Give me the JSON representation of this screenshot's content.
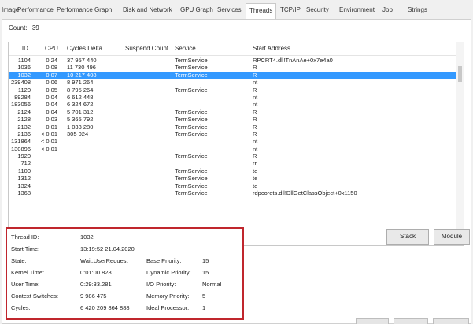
{
  "tabs": [
    "Image",
    "Performance",
    "Performance Graph",
    "Disk and Network",
    "GPU Graph",
    "Services",
    "Threads",
    "TCP/IP",
    "Security",
    "Environment",
    "Job",
    "Strings"
  ],
  "active_tab": "Threads",
  "count_label": "Count:",
  "count_value": "39",
  "columns": {
    "tid": "TID",
    "cpu": "CPU",
    "cycles": "Cycles Delta",
    "suspend": "Suspend Count",
    "service": "Service",
    "start": "Start Address"
  },
  "rows": [
    {
      "tid": "1104",
      "cpu": "0.24",
      "cycles": "37 957 440",
      "service": "TermService",
      "start": "RPCRT4.dll!TnAnAe+0x7e4a0"
    },
    {
      "tid": "1036",
      "cpu": "0.08",
      "cycles": "11 730 496",
      "service": "TermService",
      "start": "R"
    },
    {
      "tid": "1032",
      "cpu": "0.07",
      "cycles": "10 217 408",
      "service": "TermService",
      "start": "R",
      "selected": true
    },
    {
      "tid": "239408",
      "cpu": "0.06",
      "cycles": "8 971 264",
      "service": "",
      "start": "nt"
    },
    {
      "tid": "1120",
      "cpu": "0.05",
      "cycles": "8 795 264",
      "service": "TermService",
      "start": "R"
    },
    {
      "tid": "89284",
      "cpu": "0.04",
      "cycles": "6 612 448",
      "service": "",
      "start": "nt"
    },
    {
      "tid": "183056",
      "cpu": "0.04",
      "cycles": "6 324 672",
      "service": "",
      "start": "nt"
    },
    {
      "tid": "2124",
      "cpu": "0.04",
      "cycles": "5 701 312",
      "service": "TermService",
      "start": "R"
    },
    {
      "tid": "2128",
      "cpu": "0.03",
      "cycles": "5 365 792",
      "service": "TermService",
      "start": "R"
    },
    {
      "tid": "2132",
      "cpu": "0.01",
      "cycles": "1 033 280",
      "service": "TermService",
      "start": "R"
    },
    {
      "tid": "2136",
      "cpu": "< 0.01",
      "cycles": "305 024",
      "service": "TermService",
      "start": "R"
    },
    {
      "tid": "131864",
      "cpu": "< 0.01",
      "cycles": "",
      "service": "",
      "start": "nt"
    },
    {
      "tid": "130896",
      "cpu": "< 0.01",
      "cycles": "",
      "service": "",
      "start": "nt"
    },
    {
      "tid": "1920",
      "cpu": "",
      "cycles": "",
      "service": "TermService",
      "start": "R"
    },
    {
      "tid": "712",
      "cpu": "",
      "cycles": "",
      "service": "",
      "start": "rr"
    },
    {
      "tid": "1100",
      "cpu": "",
      "cycles": "",
      "service": "TermService",
      "start": "te"
    },
    {
      "tid": "1312",
      "cpu": "",
      "cycles": "",
      "service": "TermService",
      "start": "te"
    },
    {
      "tid": "1324",
      "cpu": "",
      "cycles": "",
      "service": "TermService",
      "start": "te"
    },
    {
      "tid": "1368",
      "cpu": "",
      "cycles": "",
      "service": "TermService",
      "start": "rdpcorets.dll!DllGetClassObject+0x1150"
    }
  ],
  "details": {
    "thread_id_label": "Thread ID:",
    "thread_id": "1032",
    "start_time_label": "Start Time:",
    "start_time": "13:19:52  21.04.2020",
    "state_label": "State:",
    "state": "Wait:UserRequest",
    "base_priority_label": "Base Priority:",
    "base_priority": "15",
    "kernel_time_label": "Kernel Time:",
    "kernel_time": "0:01:00.828",
    "dynamic_priority_label": "Dynamic Priority:",
    "dynamic_priority": "15",
    "user_time_label": "User Time:",
    "user_time": "0:29:33.281",
    "io_priority_label": "I/O Priority:",
    "io_priority": "Normal",
    "context_switches_label": "Context Switches:",
    "context_switches": "9 986 475",
    "memory_priority_label": "Memory Priority:",
    "memory_priority": "5",
    "cycles_label": "Cycles:",
    "cycles": "6 420 209 864 888",
    "ideal_processor_label": "Ideal Processor:",
    "ideal_processor": "1"
  },
  "buttons": {
    "stack": "Stack",
    "module": "Module"
  }
}
